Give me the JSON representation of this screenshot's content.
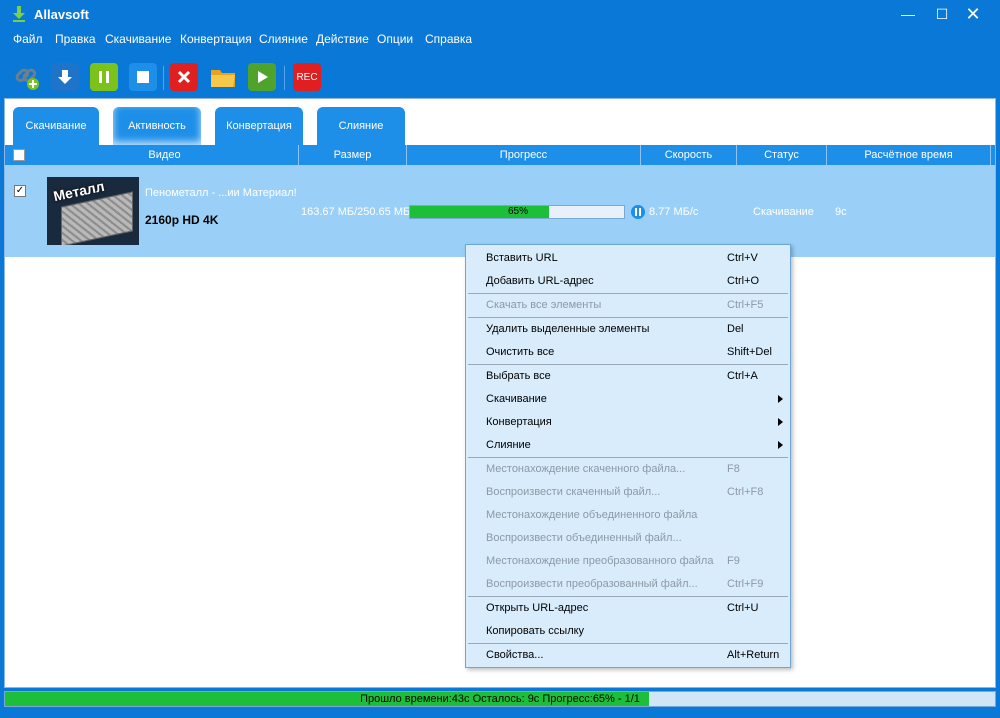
{
  "window": {
    "title": "Allavsoft",
    "minimize": "—",
    "maximize": "☐",
    "close": "✕"
  },
  "menu": [
    "Файл",
    "Правка",
    "Скачивание",
    "Конвертация",
    "Слияние",
    "Действие",
    "Опции",
    "Справка"
  ],
  "toolbar": {
    "icons": [
      "add-link-icon",
      "download-icon",
      "pause-icon",
      "stop-icon",
      "delete-icon",
      "open-folder-icon",
      "play-icon",
      "record-icon"
    ],
    "rec_label": "REC",
    "colors": {
      "link": "#6e7f8c",
      "download": "#1e74c8",
      "pause": "#7bc21b",
      "stop": "#1e8fe8",
      "delete": "#e02020",
      "folder": "#f5b82e",
      "play": "#4fa32a",
      "rec": "#e02020"
    }
  },
  "tabs": [
    {
      "label": "Скачивание"
    },
    {
      "label": "Активность"
    },
    {
      "label": "Конвертация"
    },
    {
      "label": "Слияние"
    }
  ],
  "columns": [
    "Видео",
    "Размер",
    "Прогресс",
    "Скорость",
    "Статус",
    "Расчётное время"
  ],
  "row": {
    "checked": "✓",
    "thumb_text": "Металл",
    "title": "Пенометалл - ...ии Материал!",
    "quality": "2160p HD 4K",
    "size": "163.67 МБ/250.65 МБ",
    "progress_value": 0.65,
    "progress_label": "65%",
    "speed": "8.77 МБ/с",
    "status": "Скачивание",
    "eta": "9с"
  },
  "context_menu": [
    {
      "label": "Вставить URL",
      "shortcut": "Ctrl+V",
      "disabled": false
    },
    {
      "label": "Добавить URL-адрес",
      "shortcut": "Ctrl+O",
      "disabled": false
    },
    {
      "label": "Скачать все элементы",
      "shortcut": "Ctrl+F5",
      "disabled": true
    },
    {
      "label": "Удалить выделенные элементы",
      "shortcut": "Del",
      "disabled": false
    },
    {
      "label": "Очистить все",
      "shortcut": "Shift+Del",
      "disabled": false
    },
    {
      "label": "Выбрать все",
      "shortcut": "Ctrl+A",
      "disabled": false
    },
    {
      "label": "Скачивание",
      "shortcut": "",
      "disabled": false,
      "submenu": true
    },
    {
      "label": "Конвертация",
      "shortcut": "",
      "disabled": false,
      "submenu": true
    },
    {
      "label": "Слияние",
      "shortcut": "",
      "disabled": false,
      "submenu": true
    },
    {
      "label": "Местонахождение скаченного файла...",
      "shortcut": "F8",
      "disabled": true
    },
    {
      "label": "Воспроизвести скаченный файл...",
      "shortcut": "Ctrl+F8",
      "disabled": true
    },
    {
      "label": "Местонахождение объединенного файла",
      "shortcut": "",
      "disabled": true
    },
    {
      "label": "Воспроизвести объединенный файл...",
      "shortcut": "",
      "disabled": true
    },
    {
      "label": "Местонахождение преобразованного файла",
      "shortcut": "F9",
      "disabled": true
    },
    {
      "label": "Воспроизвести преобразованный файл...",
      "shortcut": "Ctrl+F9",
      "disabled": true
    },
    {
      "label": "Открыть URL-адрес",
      "shortcut": "Ctrl+U",
      "disabled": false
    },
    {
      "label": "Копировать ссылку",
      "shortcut": "",
      "disabled": false
    },
    {
      "label": "Свойства...",
      "shortcut": "Alt+Return",
      "disabled": false
    }
  ],
  "statusbar": {
    "progress_value": 0.65,
    "text": "Прошло времени:43с Осталось: 9с Прогресс:65% - 1/1"
  }
}
